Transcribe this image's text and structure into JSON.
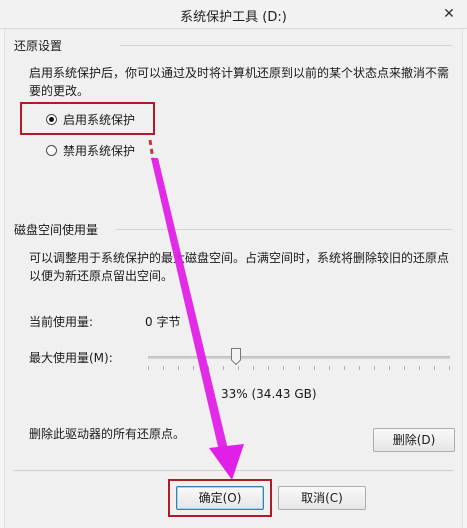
{
  "window": {
    "title": "系统保护工具 (D:)",
    "close_glyph": "✕"
  },
  "restore_settings": {
    "group_label": "还原设置",
    "description": "启用系统保护后，你可以通过及时将计算机还原到以前的某个状态点来撤消不需要的更改。",
    "options": [
      {
        "label": "启用系统保护",
        "checked": true
      },
      {
        "label": "禁用系统保护",
        "checked": false
      }
    ]
  },
  "disk_usage": {
    "group_label": "磁盘空间使用量",
    "description": "可以调整用于系统保护的最大磁盘空间。占满空间时，系统将删除较旧的还原点以便为新还原点留出空间。",
    "current_usage_label": "当前使用量:",
    "current_usage_value": "0 字节",
    "max_usage_label": "最大使用量(M):",
    "max_usage_percent": 33,
    "max_usage_readout": "33% (34.43 GB)"
  },
  "delete_section": {
    "text": "删除此驱动器的所有还原点。",
    "delete_button": "删除(D)"
  },
  "footer": {
    "ok_button": "确定(O)",
    "cancel_button": "取消(C)"
  },
  "annotation_colors": {
    "highlight_box": "#b01a2a",
    "arrow": "#e020e6"
  }
}
